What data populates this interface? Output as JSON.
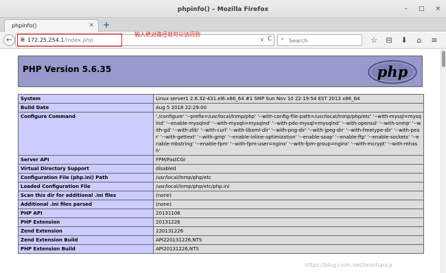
{
  "window": {
    "title": "phpinfo() – Mozilla Firefox",
    "controls": [
      "–",
      "□",
      "×"
    ]
  },
  "tabs": [
    {
      "label": "phpinfo()",
      "close": "×"
    }
  ],
  "newtab_label": "+",
  "navbar": {
    "back": "←",
    "url_host": "172.25.254.1",
    "url_path": "/index.php",
    "dropdown": "∨",
    "reload": "C",
    "search_placeholder": "Search",
    "search_icon": "⌕",
    "icons": [
      "☆",
      "⊟",
      "⬇",
      "⌂",
      "≡"
    ],
    "icon_names": [
      "bookmark-star-icon",
      "reader-icon",
      "download-icon",
      "home-icon",
      "menu-icon"
    ]
  },
  "annotation": "输入绝对路径就可以访问到",
  "page": {
    "version_title": "PHP Version 5.6.35",
    "logo_text": "php",
    "rows": [
      {
        "key": "System",
        "value": "Linux server1 2.6.32-431.el6.x86_64 #1 SMP Sun Nov 10 22:19:54 EST 2013 x86_64"
      },
      {
        "key": "Build Date",
        "value": "Aug 5 2018 22:29:00"
      },
      {
        "key": "Configure Command",
        "value": "'./configure' '--prefix=/usr/local/lnmp/php' '--with-config-file-path=/usr/local/lnmp/php/etc' '--with-mysql=mysqlnd' '--enable-mysqlnd' '--with-mysqli=mysqlnd' '--with-pdo-mysql=mysqlnd' '--with-openssl' '--with-snmp' '--with-gd' '--with-zlib' '--with-curl' '--with-libxml-dir' '--with-png-dir' '--with-jpeg-dir' '--with-freetype-dir' '--with-pear' '--with-gettext' '--with-gmp' '--enable-inline-optimization' '--enable-soap' '--enable-ftp' '--enable-sockets' '--enable-mbstring' '--enable-fpm' '--with-fpm-user=nginx' '--with-fpm-group=nginx' '--with-mcrypt' '--with-mhash'"
      },
      {
        "key": "Server API",
        "value": "FPM/FastCGI"
      },
      {
        "key": "Virtual Directory Support",
        "value": "disabled"
      },
      {
        "key": "Configuration File (php.ini) Path",
        "value": "/usr/local/lnmp/php/etc"
      },
      {
        "key": "Loaded Configuration File",
        "value": "/usr/local/lnmp/php/etc/php.ini"
      },
      {
        "key": "Scan this dir for additional .ini files",
        "value": "(none)"
      },
      {
        "key": "Additional .ini files parsed",
        "value": "(none)"
      },
      {
        "key": "PHP API",
        "value": "20131106"
      },
      {
        "key": "PHP Extension",
        "value": "20131226"
      },
      {
        "key": "Zend Extension",
        "value": "220131226"
      },
      {
        "key": "Zend Extension Build",
        "value": "API220131226,NTS"
      },
      {
        "key": "PHP Extension Build",
        "value": "API20131226,NTS"
      }
    ]
  },
  "watermark": "https://blog.csdn.net/lmmhancy",
  "colors": {
    "header_bg": "#9999cc",
    "key_bg": "#ccccff",
    "value_bg": "#dddddd",
    "annotation": "#d81e1e",
    "url_highlight_border": "#e02020"
  }
}
